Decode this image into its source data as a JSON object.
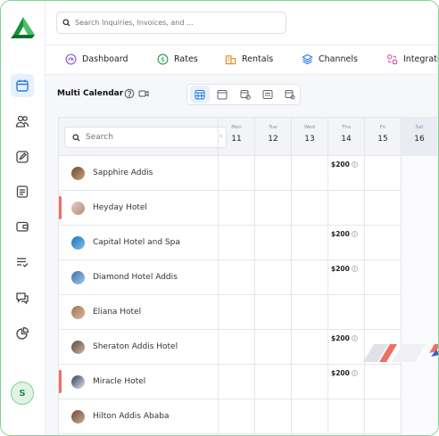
{
  "search": {
    "placeholder": "Search Inquiries, Invoices, and ..."
  },
  "nav": [
    {
      "label": "Dashboard",
      "icon": "dashboard-icon"
    },
    {
      "label": "Rates",
      "icon": "dollar-icon"
    },
    {
      "label": "Rentals",
      "icon": "building-icon"
    },
    {
      "label": "Channels",
      "icon": "layers-icon"
    },
    {
      "label": "Integrati",
      "icon": "integration-icon"
    }
  ],
  "page": {
    "title": "Multi Calendar"
  },
  "grid": {
    "search_placeholder": "Search",
    "days": [
      {
        "name": "Mon",
        "num": "11"
      },
      {
        "name": "Tue",
        "num": "12"
      },
      {
        "name": "Wed",
        "num": "13"
      },
      {
        "name": "Thu",
        "num": "14"
      },
      {
        "name": "Fri",
        "num": "15"
      },
      {
        "name": "Sat",
        "num": "16"
      }
    ],
    "rows": [
      {
        "name": "Sapphire Addis",
        "price": "$200"
      },
      {
        "name": "Heyday Hotel",
        "price": ""
      },
      {
        "name": "Capital Hotel and Spa",
        "price": "$200"
      },
      {
        "name": "Diamond Hotel Addis",
        "price": "$200"
      },
      {
        "name": "Eliana Hotel",
        "price": ""
      },
      {
        "name": "Sheraton Addis Hotel",
        "price": "$200"
      },
      {
        "name": "Miracle Hotel",
        "price": "$200"
      },
      {
        "name": "Hilton Addis Ababa",
        "price": ""
      }
    ]
  },
  "user": {
    "initial": "S"
  },
  "colors": {
    "brand": "#2a9d4a",
    "accent": "#2b7de0",
    "active_bg": "#e6f1fb",
    "stripe_red": "#ef6f5e"
  }
}
